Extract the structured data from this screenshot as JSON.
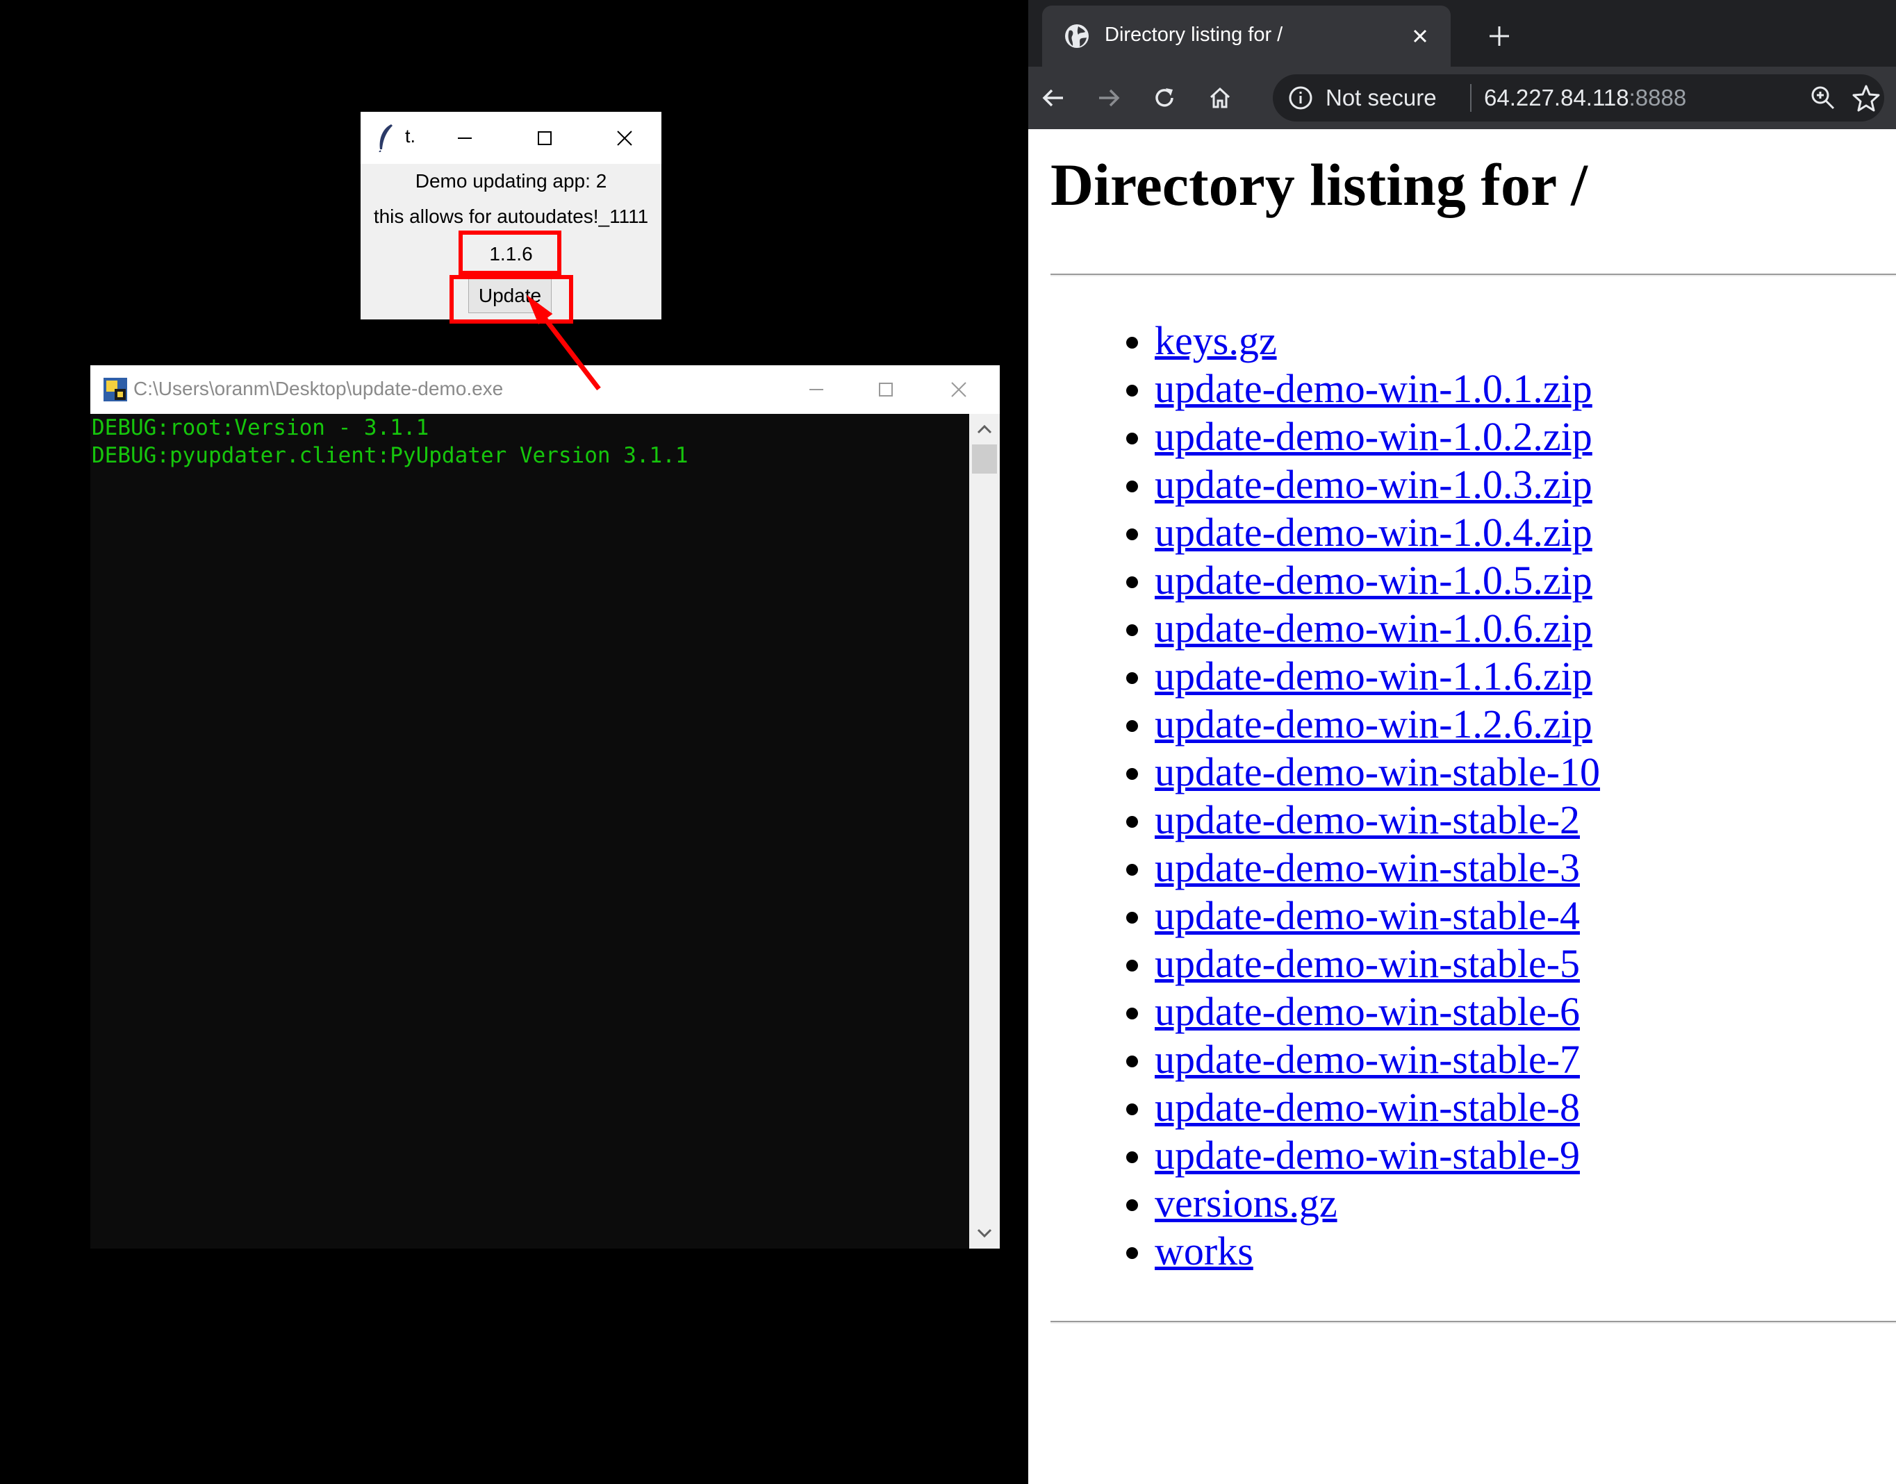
{
  "tk_window": {
    "title": "t.",
    "label_1": "Demo updating app: 2",
    "label_2": "this allows for autoudates!_1111",
    "version": "1.1.6",
    "update_button": "Update"
  },
  "console": {
    "title": "C:\\Users\\oranm\\Desktop\\update-demo.exe",
    "lines": [
      "DEBUG:root:Version - 3.1.1",
      "DEBUG:pyupdater.client:PyUpdater Version 3.1.1"
    ],
    "text_color": "#16c60c"
  },
  "browser": {
    "tab_title": "Directory listing for /",
    "security_label": "Not secure",
    "url_host": "64.227.84.118",
    "url_port": ":8888",
    "heading": "Directory listing for /",
    "files": [
      "keys.gz",
      "update-demo-win-1.0.1.zip",
      "update-demo-win-1.0.2.zip",
      "update-demo-win-1.0.3.zip",
      "update-demo-win-1.0.4.zip",
      "update-demo-win-1.0.5.zip",
      "update-demo-win-1.0.6.zip",
      "update-demo-win-1.1.6.zip",
      "update-demo-win-1.2.6.zip",
      "update-demo-win-stable-10",
      "update-demo-win-stable-2",
      "update-demo-win-stable-3",
      "update-demo-win-stable-4",
      "update-demo-win-stable-5",
      "update-demo-win-stable-6",
      "update-demo-win-stable-7",
      "update-demo-win-stable-8",
      "update-demo-win-stable-9",
      "versions.gz",
      "works"
    ],
    "link_color": "#0000ee"
  },
  "annotation": {
    "highlight_color": "#ff0000"
  }
}
